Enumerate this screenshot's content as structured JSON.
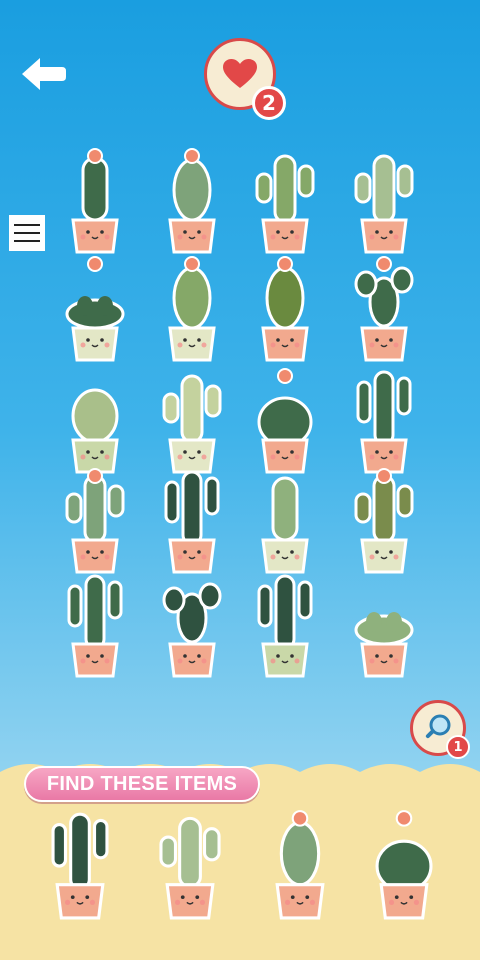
{
  "header": {
    "back_icon": "back-arrow-icon",
    "lives_icon": "heart-icon",
    "lives_count": "2"
  },
  "menu": {
    "icon": "hamburger-menu-icon"
  },
  "hint": {
    "icon": "magnifier-icon",
    "count": "1"
  },
  "find_panel": {
    "title": "FIND THESE ITEMS"
  },
  "colors": {
    "sky_top": "#1a9ee0",
    "sky_bottom": "#b9e4f4",
    "sand": "#f6e3a4",
    "pot": "#f2a98e",
    "pot_cream": "#e3e7c6",
    "heart": "#e24848",
    "pill": "#e979a6"
  },
  "grid_items": [
    {
      "name": "cactus-tall-flower",
      "type": "tall",
      "body": "#3f6b4a",
      "pot": "#f2a98e",
      "flower": true
    },
    {
      "name": "cactus-oval-flower",
      "type": "oval",
      "body": "#7ea37a",
      "pot": "#f2a98e",
      "flower": true
    },
    {
      "name": "cactus-arms",
      "type": "arms",
      "body": "#85a868",
      "pot": "#f2a98e",
      "flower": false
    },
    {
      "name": "cactus-arms-light",
      "type": "arms",
      "body": "#a6bf92",
      "pot": "#f2a98e",
      "flower": false
    },
    {
      "name": "cactus-clump",
      "type": "clump",
      "body": "#3f6b4a",
      "pot": "#e3e7c6",
      "flower": true
    },
    {
      "name": "cactus-oval-pink",
      "type": "oval",
      "body": "#85a868",
      "pot": "#e3e7c6",
      "flower": true
    },
    {
      "name": "cactus-oval-olive",
      "type": "oval",
      "body": "#6a8a3f",
      "pot": "#f2a98e",
      "flower": true
    },
    {
      "name": "cactus-paddles",
      "type": "paddles",
      "body": "#3f6b4a",
      "pot": "#f2a98e",
      "flower": true
    },
    {
      "name": "cactus-round",
      "type": "round",
      "body": "#a9bf8a",
      "pot": "#c9d8a8",
      "flower": false
    },
    {
      "name": "cactus-small-arms",
      "type": "arms",
      "body": "#c4d29e",
      "pot": "#e3e7c6",
      "flower": false
    },
    {
      "name": "cactus-barrel",
      "type": "barrel",
      "body": "#3f6b4a",
      "pot": "#f2a98e",
      "flower": true
    },
    {
      "name": "cactus-saguaro",
      "type": "saguaro",
      "body": "#3f6b4a",
      "pot": "#f2a98e",
      "flower": false
    },
    {
      "name": "cactus-tall-arms",
      "type": "arms",
      "body": "#7ea37a",
      "pot": "#f2a98e",
      "flower": true
    },
    {
      "name": "cactus-saguaro-dark",
      "type": "saguaro",
      "body": "#2f5240",
      "pot": "#f2a98e",
      "flower": false
    },
    {
      "name": "cactus-grid",
      "type": "tall",
      "body": "#8fb17d",
      "pot": "#e3e7c6",
      "flower": false
    },
    {
      "name": "cactus-spiky-arms",
      "type": "arms",
      "body": "#7a8c4c",
      "pot": "#e3e7c6",
      "flower": true
    },
    {
      "name": "cactus-saguaro-green",
      "type": "saguaro",
      "body": "#3f6b4a",
      "pot": "#f2a98e",
      "flower": false
    },
    {
      "name": "cactus-paddle-dots",
      "type": "paddles",
      "body": "#2f5240",
      "pot": "#f2a98e",
      "flower": false
    },
    {
      "name": "cactus-column",
      "type": "saguaro",
      "body": "#2f5240",
      "pot": "#c9d8a8",
      "flower": false
    },
    {
      "name": "cactus-bunny",
      "type": "clump",
      "body": "#8fb17d",
      "pot": "#f2a98e",
      "flower": false
    }
  ],
  "targets": [
    {
      "name": "target-saguaro",
      "type": "saguaro",
      "body": "#2f5240",
      "pot": "#f2a98e",
      "flower": false
    },
    {
      "name": "target-arms-light",
      "type": "arms",
      "body": "#a6bf92",
      "pot": "#f2a98e",
      "flower": false
    },
    {
      "name": "target-oval-flower",
      "type": "oval",
      "body": "#7ea37a",
      "pot": "#f2a98e",
      "flower": true
    },
    {
      "name": "target-barrel",
      "type": "barrel",
      "body": "#3f6b4a",
      "pot": "#f2a98e",
      "flower": true
    }
  ]
}
